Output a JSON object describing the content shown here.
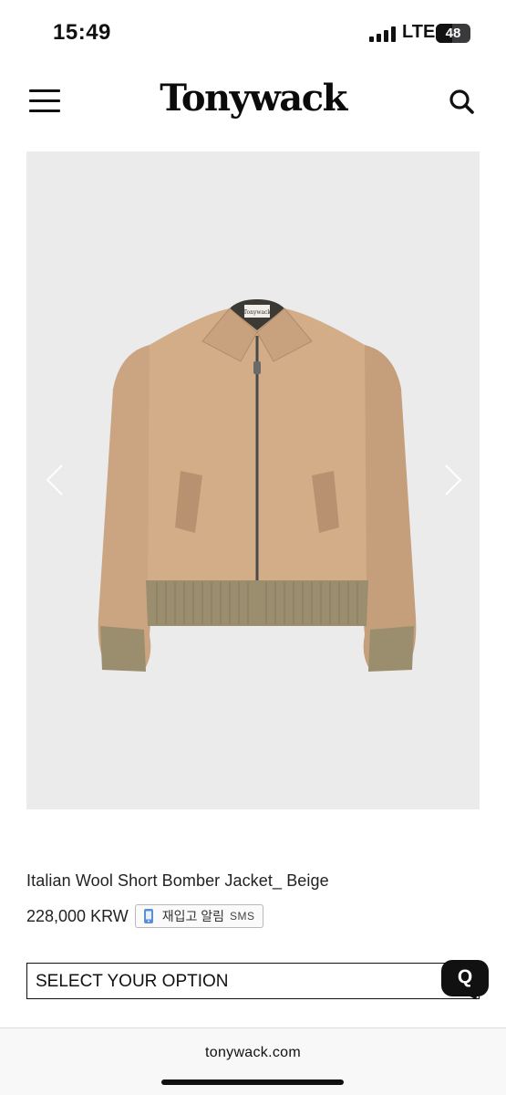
{
  "status_bar": {
    "time": "15:49",
    "network": "LTE",
    "battery_level": "48",
    "battery_fraction": 0.48
  },
  "header": {
    "brand": "Tonywack"
  },
  "product": {
    "image_label": "Tonywack",
    "name": "Italian Wool Short Bomber Jacket_ Beige",
    "price": "228,000 KRW",
    "restock_label": "재입고 알림",
    "restock_channel": "SMS"
  },
  "option_select": {
    "placeholder": "SELECT YOUR OPTION"
  },
  "chat_button": {
    "letter": "Q"
  },
  "browser": {
    "url": "tonywack.com"
  },
  "colors": {
    "jacket": "#d2ad88",
    "rib": "#9a8e6f",
    "background": "#ebebeb",
    "accent": "#111111"
  },
  "icons": [
    "menu-icon",
    "search-icon",
    "chevron-left-icon",
    "chevron-right-icon",
    "bell-icon",
    "chat-icon"
  ]
}
